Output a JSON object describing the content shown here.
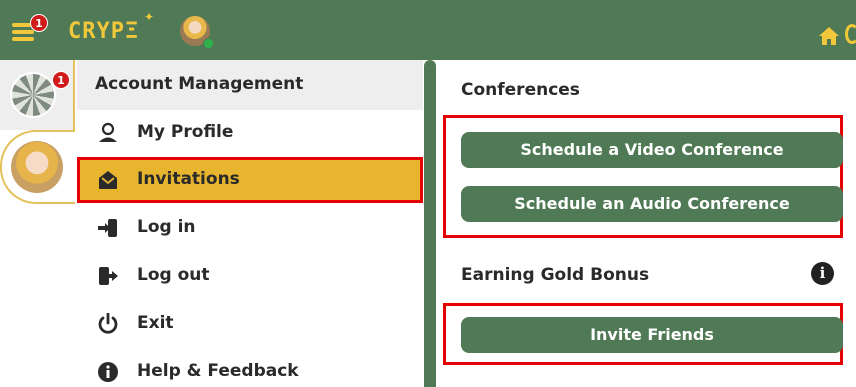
{
  "topbar": {
    "logo_text": "CRYPΞ",
    "logo_star": "✦",
    "notification_count": "1",
    "colors": {
      "bar": "#4f7a55",
      "accent": "#f0c83a",
      "badge": "#d11a1a"
    }
  },
  "rail": {
    "group_badge_count": "1"
  },
  "menu": {
    "title": "Account Management",
    "items": [
      {
        "label": "My Profile",
        "icon": "user-icon"
      },
      {
        "label": "Invitations",
        "icon": "envelope-icon"
      },
      {
        "label": "Log in",
        "icon": "login-icon"
      },
      {
        "label": "Log out",
        "icon": "logout-icon"
      },
      {
        "label": "Exit",
        "icon": "power-icon"
      },
      {
        "label": "Help & Feedback",
        "icon": "info-icon"
      }
    ],
    "active_item": "Invitations"
  },
  "right": {
    "conferences_title": "Conferences",
    "video_button": "Schedule a Video Conference",
    "audio_button": "Schedule an Audio Conference",
    "bonus_title": "Earning Gold Bonus",
    "invite_button": "Invite Friends",
    "info_glyph": "i"
  }
}
